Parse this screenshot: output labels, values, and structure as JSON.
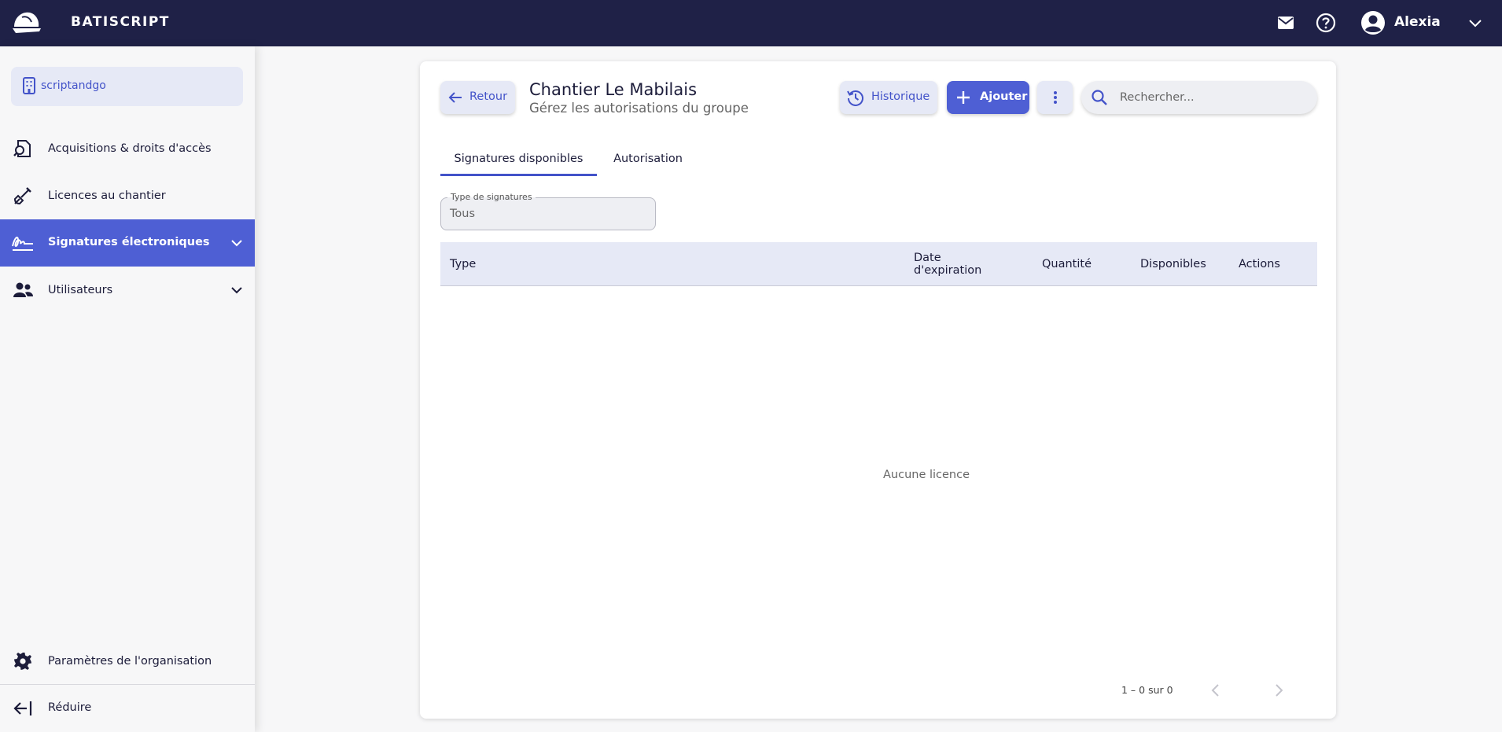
{
  "app": {
    "name": "BATISCRIPT"
  },
  "header": {
    "user_name": "Alexia",
    "icons": [
      "hardhat-logo-icon",
      "mail-icon",
      "help-icon",
      "account-circle-icon",
      "chevron-down-icon"
    ]
  },
  "sidebar": {
    "org": "scriptandgo",
    "items": [
      {
        "label": "Acquisitions & droits d'accès",
        "icon": "search-document-icon"
      },
      {
        "label": "Licences au chantier",
        "icon": "shovel-icon"
      },
      {
        "label": "Signatures électroniques",
        "icon": "signature-icon",
        "active": true
      },
      {
        "label": "Utilisateurs",
        "icon": "users-icon"
      }
    ],
    "bottom": {
      "settings_label": "Paramètres de l'organisation",
      "collapse_label": "Réduire"
    }
  },
  "main": {
    "back_label": "Retour",
    "title": "Chantier Le Mabilais",
    "subtitle": "Gérez les autorisations du groupe",
    "history_label": "Historique",
    "add_label": "Ajouter",
    "search_placeholder": "Rechercher...",
    "tabs": [
      {
        "label": "Signatures disponibles",
        "active": true
      },
      {
        "label": "Autorisation"
      }
    ],
    "filter": {
      "label": "Type de signatures",
      "value": "Tous"
    },
    "table": {
      "columns": [
        "Type",
        "Date d'expiration",
        "Quantité",
        "Disponibles",
        "Actions"
      ],
      "rows": [],
      "empty_message": "Aucune licence"
    },
    "pagination": {
      "range": "1 – 0 sur 0"
    }
  },
  "colors": {
    "topbar": "#1f2147",
    "accent": "#4e5fd4",
    "accent_text": "#4353c9",
    "chip_bg": "#e6e9f6"
  }
}
